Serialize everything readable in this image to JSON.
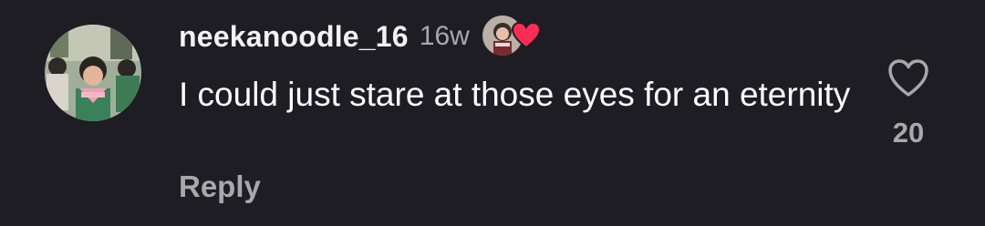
{
  "comment": {
    "username": "neekanoodle_16",
    "timestamp": "16w",
    "text": "I could just stare at those eyes for an eternity",
    "reply_label": "Reply",
    "like_count": "20"
  },
  "icons": {
    "avatar": "profile-photo",
    "reaction_avatar": "creator-avatar",
    "reaction_badge": "heart-icon",
    "like": "heart-outline-icon"
  },
  "colors": {
    "background": "#1e1d23",
    "primary_text": "#ffffff",
    "secondary_text": "#a8a8ab",
    "heart_red": "#fe2c55"
  }
}
